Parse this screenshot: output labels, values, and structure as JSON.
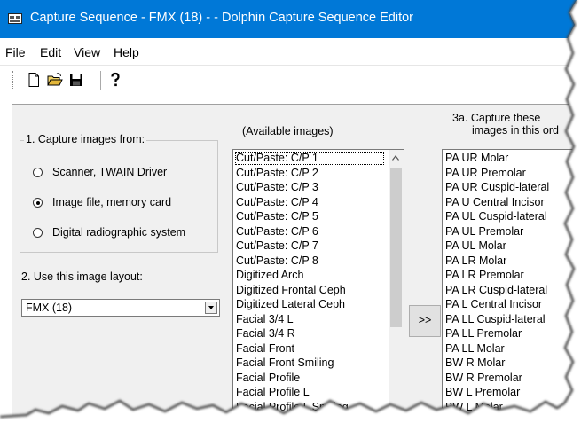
{
  "window": {
    "title": "Capture Sequence - FMX (18) -  - Dolphin Capture Sequence Editor"
  },
  "menu": {
    "file": "File",
    "edit": "Edit",
    "view": "View",
    "help": "Help"
  },
  "toolbar": {
    "new_icon": "new-document-icon",
    "open_icon": "open-folder-icon",
    "save_icon": "save-disk-icon",
    "help_icon": "help-question-icon"
  },
  "capture": {
    "group_label": "1. Capture images from:",
    "options": [
      {
        "label": "Scanner, TWAIN Driver",
        "selected": false
      },
      {
        "label": "Image file, memory card",
        "selected": true
      },
      {
        "label": "Digital radiographic system",
        "selected": false
      }
    ]
  },
  "layout": {
    "label": "2. Use this image layout:",
    "value": "FMX (18)"
  },
  "available": {
    "label": "(Available images)",
    "items": [
      "Cut/Paste: C/P 1",
      "Cut/Paste: C/P 2",
      "Cut/Paste: C/P 3",
      "Cut/Paste: C/P 4",
      "Cut/Paste: C/P 5",
      "Cut/Paste: C/P 6",
      "Cut/Paste: C/P 7",
      "Cut/Paste: C/P 8",
      "Digitized Arch",
      "Digitized Frontal Ceph",
      "Digitized Lateral Ceph",
      "Facial 3/4 L",
      "Facial 3/4 R",
      "Facial Front",
      "Facial Front Smiling",
      "Facial Profile",
      "Facial Profile L",
      "Facial Profile L Smiling"
    ]
  },
  "move_button": ">>",
  "selected": {
    "label_line1": "3a. Capture these",
    "label_line2": "images in this ord",
    "items": [
      "PA UR Molar",
      "PA UR Premolar",
      "PA UR Cuspid-lateral",
      "PA U Central Incisor",
      "PA UL Cuspid-lateral",
      "PA UL Premolar",
      "PA UL Molar",
      "PA LR Molar",
      "PA LR Premolar",
      "PA LR Cuspid-lateral",
      "PA L Central Incisor",
      "PA LL Cuspid-lateral",
      "PA LL Premolar",
      "PA LL Molar",
      "BW R Molar",
      "BW R Premolar",
      "BW L Premolar",
      "BW L Molar"
    ]
  },
  "colors": {
    "titlebar": "#0078d7",
    "dialog_bg": "#f0f0f0"
  }
}
